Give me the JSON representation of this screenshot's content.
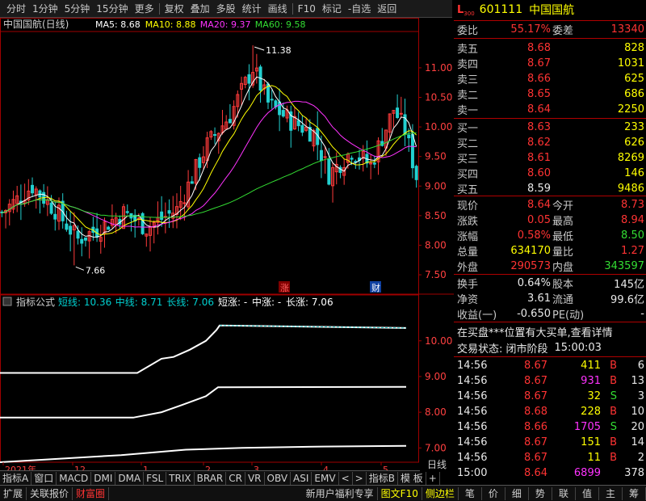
{
  "toolbar": {
    "items": [
      "分时",
      "1分钟",
      "5分钟",
      "15分钟",
      "更多",
      "复权",
      "叠加",
      "多股",
      "统计",
      "画线",
      "F10",
      "标记",
      "-自选",
      "返回"
    ]
  },
  "stock": {
    "code": "601111",
    "name": "中国国航",
    "badge": "L",
    "badge_sub": "300"
  },
  "main_chart": {
    "title": "中国国航(日线)",
    "ma": [
      {
        "label": "MA5: 8.68",
        "color": "#ffffff"
      },
      {
        "label": "MA10: 8.88",
        "color": "#ffff00"
      },
      {
        "label": "MA20: 9.37",
        "color": "#ff33ff"
      },
      {
        "label": "MA60: 9.58",
        "color": "#33dd33"
      }
    ],
    "high_marker": "11.38",
    "low_marker": "7.66",
    "markers": [
      "涨",
      "财"
    ]
  },
  "indicator": {
    "name": "指标公式",
    "items": [
      {
        "label": "短线: 10.36",
        "color": "#00d0d0"
      },
      {
        "label": "中线: 8.71",
        "color": "#00d0d0"
      },
      {
        "label": "长线: 7.06",
        "color": "#00d0d0"
      },
      {
        "label": "短涨: -",
        "color": "#ffffff"
      },
      {
        "label": "中涨: -",
        "color": "#ffffff"
      },
      {
        "label": "长涨: 7.06",
        "color": "#ffffff"
      }
    ]
  },
  "x_axis": {
    "labels": [
      "2021年",
      "12",
      "1",
      "2",
      "3",
      "4",
      "5"
    ],
    "mode": "日线"
  },
  "y_axis_main": [
    "11.00",
    "10.50",
    "10.00",
    "9.50",
    "9.00",
    "8.50",
    "8.00",
    "7.50"
  ],
  "y_axis_ind": [
    "10.00",
    "9.00",
    "8.00",
    "7.00"
  ],
  "chart_data": [
    {
      "type": "candlestick",
      "title": "中国国航(日线)",
      "ylim": [
        7.2,
        11.6
      ],
      "series": [
        {
          "name": "MA5",
          "last": 8.68
        },
        {
          "name": "MA10",
          "last": 8.88
        },
        {
          "name": "MA20",
          "last": 9.37
        },
        {
          "name": "MA60",
          "last": 9.58
        }
      ],
      "annotations": [
        {
          "text": "11.38"
        },
        {
          "text": "7.66"
        }
      ]
    },
    {
      "type": "line",
      "title": "指标公式",
      "ylim": [
        6.6,
        10.9
      ],
      "series": [
        {
          "name": "短线",
          "last": 10.36
        },
        {
          "name": "中线",
          "last": 8.71
        },
        {
          "name": "长线",
          "last": 7.06
        }
      ]
    }
  ],
  "quote": {
    "weibi_label": "委比",
    "weibi": "55.17%",
    "weicha_label": "委差",
    "weicha": "13340",
    "asks": [
      {
        "label": "卖五",
        "price": "8.68",
        "vol": "828"
      },
      {
        "label": "卖四",
        "price": "8.67",
        "vol": "1031"
      },
      {
        "label": "卖三",
        "price": "8.66",
        "vol": "625"
      },
      {
        "label": "卖二",
        "price": "8.65",
        "vol": "686"
      },
      {
        "label": "卖一",
        "price": "8.64",
        "vol": "2250"
      }
    ],
    "bids": [
      {
        "label": "买一",
        "price": "8.63",
        "vol": "233"
      },
      {
        "label": "买二",
        "price": "8.62",
        "vol": "626"
      },
      {
        "label": "买三",
        "price": "8.61",
        "vol": "8269"
      },
      {
        "label": "买四",
        "price": "8.60",
        "vol": "146"
      },
      {
        "label": "买五",
        "price": "8.59",
        "vol": "9486"
      }
    ],
    "stats": [
      {
        "l1": "现价",
        "v1": "8.64",
        "c1": "red",
        "l2": "今开",
        "v2": "8.73",
        "c2": "red"
      },
      {
        "l1": "涨跌",
        "v1": "0.05",
        "c1": "red",
        "l2": "最高",
        "v2": "8.94",
        "c2": "red"
      },
      {
        "l1": "涨幅",
        "v1": "0.58%",
        "c1": "red",
        "l2": "最低",
        "v2": "8.50",
        "c2": "grn"
      },
      {
        "l1": "总量",
        "v1": "634170",
        "c1": "yel",
        "l2": "量比",
        "v2": "1.27",
        "c2": "red"
      },
      {
        "l1": "外盘",
        "v1": "290573",
        "c1": "red",
        "l2": "内盘",
        "v2": "343597",
        "c2": "grn"
      }
    ],
    "stats2": [
      {
        "l1": "换手",
        "v1": "0.64%",
        "l2": "股本",
        "v2": "145亿"
      },
      {
        "l1": "净资",
        "v1": "3.61",
        "l2": "流通",
        "v2": "99.6亿"
      },
      {
        "l1": "收益(一)",
        "v1": "-0.650",
        "l2": "PE(动)",
        "v2": "-"
      }
    ],
    "notice": "在买盘***位置有大买单,查看详情",
    "status_label": "交易状态: 闭市阶段",
    "status_time": "15:00:03",
    "ticks": [
      {
        "t": "14:56",
        "p": "8.67",
        "v": "411",
        "d": "B",
        "n": "6",
        "vc": "yel",
        "dc": "red"
      },
      {
        "t": "14:56",
        "p": "8.67",
        "v": "931",
        "d": "B",
        "n": "13",
        "vc": "mag",
        "dc": "red"
      },
      {
        "t": "14:56",
        "p": "8.67",
        "v": "32",
        "d": "S",
        "n": "3",
        "vc": "yel",
        "dc": "grn"
      },
      {
        "t": "14:56",
        "p": "8.68",
        "v": "228",
        "d": "B",
        "n": "10",
        "vc": "yel",
        "dc": "red"
      },
      {
        "t": "14:56",
        "p": "8.66",
        "v": "1705",
        "d": "S",
        "n": "20",
        "vc": "mag",
        "dc": "grn"
      },
      {
        "t": "14:56",
        "p": "8.67",
        "v": "151",
        "d": "B",
        "n": "14",
        "vc": "yel",
        "dc": "red"
      },
      {
        "t": "14:56",
        "p": "8.67",
        "v": "11",
        "d": "B",
        "n": "2",
        "vc": "yel",
        "dc": "red"
      },
      {
        "t": "15:00",
        "p": "8.64",
        "v": "6899",
        "d": "",
        "n": "378",
        "vc": "mag",
        "dc": "wht"
      }
    ]
  },
  "bottom_tabs": [
    "指标A",
    "窗口",
    "MACD",
    "DMI",
    "DMA",
    "FSL",
    "TRIX",
    "BRAR",
    "CR",
    "VR",
    "OBV",
    "ASI",
    "EMV",
    "<",
    ">",
    "指标B",
    "模 板",
    "+"
  ],
  "bottom_bar": {
    "left": [
      {
        "t": "扩展",
        "c": "#d0d0d0"
      },
      {
        "t": "关联报价",
        "c": "#d0d0d0"
      },
      {
        "t": "财富圈",
        "c": "#ff3333"
      }
    ],
    "mid": [
      {
        "t": "新用户福利专享",
        "c": "#d0d0d0"
      },
      {
        "t": "图文F10",
        "c": "#ffff00"
      },
      {
        "t": "侧边栏",
        "c": "#ffff00"
      }
    ],
    "right": [
      "笔",
      "价",
      "细",
      "势",
      "联",
      "值",
      "主",
      "筹"
    ]
  }
}
